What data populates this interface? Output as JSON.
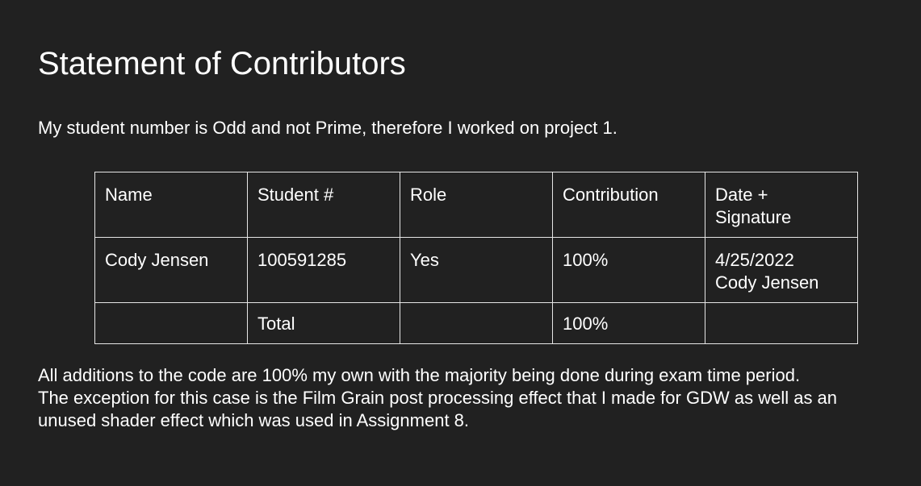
{
  "document": {
    "title": "Statement of Contributors",
    "intro": "My student number is Odd and not Prime, therefore I worked on project 1.",
    "table": {
      "headers": [
        "Name",
        "Student #",
        "Role",
        "Contribution",
        "Date +",
        "Signature"
      ],
      "row1": {
        "name": "Cody Jensen",
        "student_number": "100591285",
        "role": "Yes",
        "contribution": "100%",
        "date": "4/25/2022",
        "signature": "Cody Jensen"
      },
      "total_row": {
        "name": "",
        "label": "Total",
        "role": "",
        "contribution": "100%",
        "date_signature": ""
      }
    },
    "outro_lines": [
      "All additions to the code are 100% my own with the majority being done during exam time period.",
      "The exception for this case is the Film Grain post processing effect that I made for GDW as well as an",
      "unused shader effect which was used in Assignment 8."
    ]
  }
}
